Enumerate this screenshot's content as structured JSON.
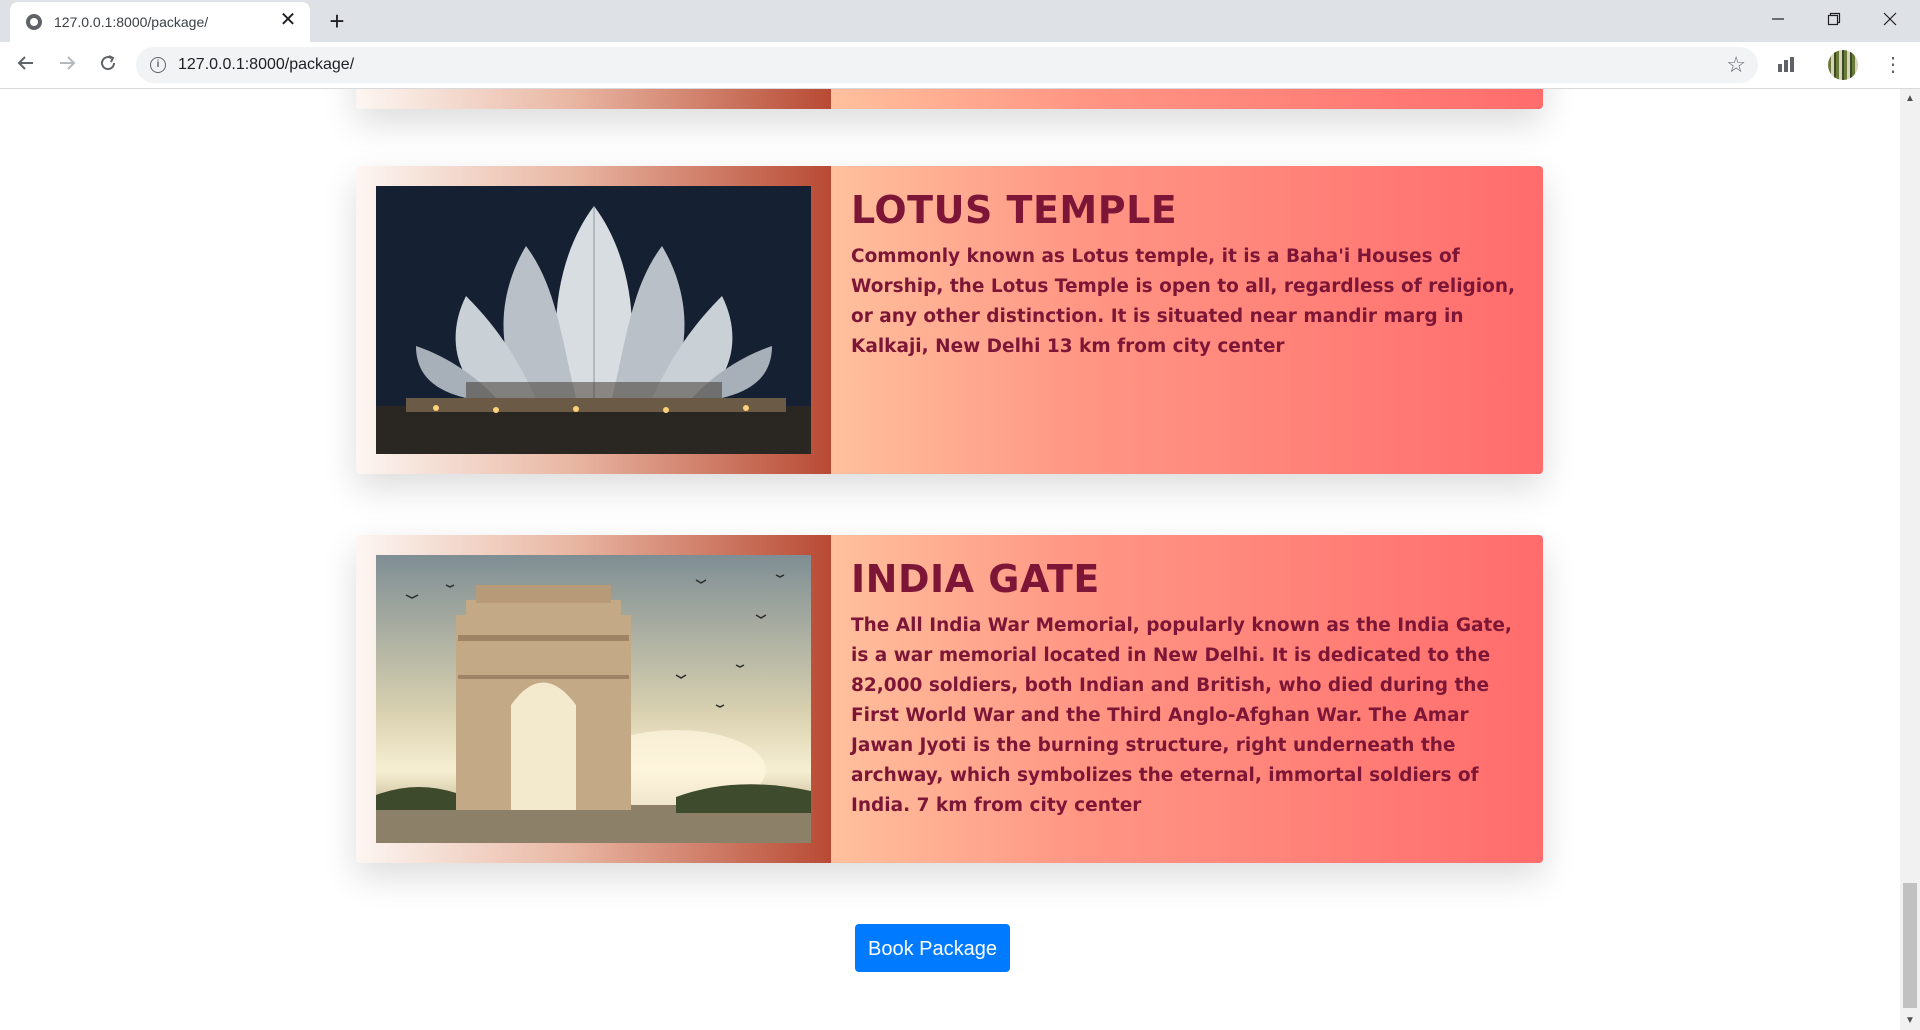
{
  "browser": {
    "tab_title": "127.0.0.1:8000/package/",
    "url": "127.0.0.1:8000/package/",
    "new_tab_symbol": "+",
    "close_symbol": "✕",
    "window_controls": [
      "minimize-icon",
      "restore-icon",
      "close-icon"
    ]
  },
  "cards": [
    {
      "title": "LOTUS TEMPLE",
      "description": "Commonly known as Lotus temple, it is a Baha'i Houses of Worship, the Lotus Temple is open to all, regardless of religion, or any other distinction. It is situated near mandir marg in Kalkaji, New Delhi 13 km from city center",
      "image_icon": "lotus-temple-photo"
    },
    {
      "title": "INDIA GATE",
      "description": "The All India War Memorial, popularly known as the India Gate, is a war memorial located in New Delhi. It is dedicated to the 82,000 soldiers, both Indian and British, who died during the First World War and the Third Anglo-Afghan War. The Amar Jawan Jyoti is the burning structure, right underneath the archway, which symbolizes the eternal, immortal soldiers of India. 7 km from city center",
      "image_icon": "india-gate-photo"
    }
  ],
  "book_button_label": "Book Package",
  "colors": {
    "title_color": "#7d1636",
    "button_color": "#007bff"
  }
}
